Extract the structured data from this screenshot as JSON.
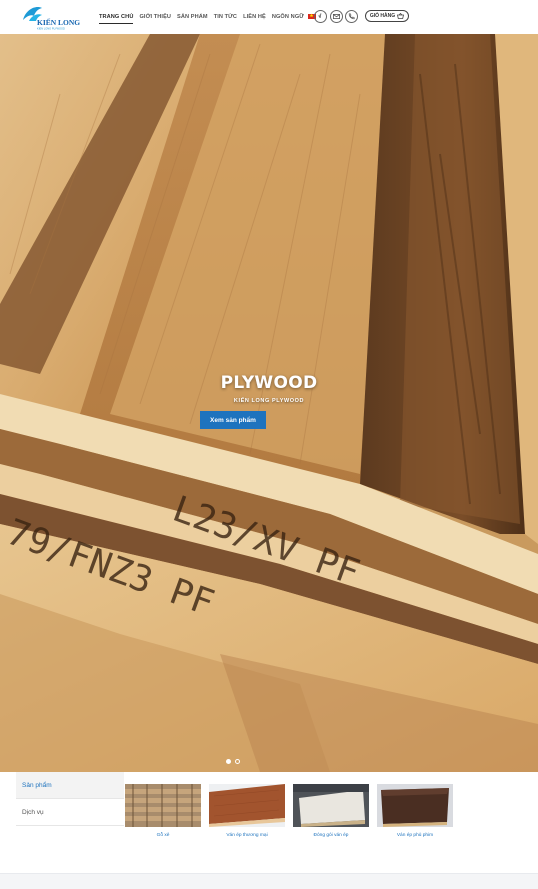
{
  "brand": {
    "name": "KIẾN LONG",
    "tagline": "KIEN LONG PLYWOOD"
  },
  "nav": {
    "items": [
      {
        "label": "TRANG CHỦ",
        "active": true
      },
      {
        "label": "GIỚI THIỆU"
      },
      {
        "label": "SẢN PHẨM"
      },
      {
        "label": "TIN TỨC"
      },
      {
        "label": "LIÊN HỆ"
      },
      {
        "label": "NGÔN NGỮ"
      }
    ],
    "language_flag": "vietnam-flag-icon",
    "social_icons": [
      "facebook-icon",
      "mail-icon",
      "phone-icon"
    ],
    "cart_label": "GIỎ HÀNG",
    "cart_icon": "basket-icon"
  },
  "hero": {
    "title": "PLYWOOD",
    "subtitle": "KIẾN LONG PLYWOOD",
    "button_label": "Xem sản phẩm",
    "slide_count": 2,
    "active_slide": 1,
    "stamps": [
      "79/FNZ3 PF",
      "L23/XV PF"
    ]
  },
  "tabs": [
    {
      "label": "Sản phẩm",
      "active": true
    },
    {
      "label": "Dịch vụ",
      "active": false
    }
  ],
  "products": [
    {
      "caption": "Gỗ xẻ"
    },
    {
      "caption": "Ván ép thương mại"
    },
    {
      "caption": "Đóng gói ván ép"
    },
    {
      "caption": "Ván ép phủ phim"
    }
  ],
  "colors": {
    "accent": "#1e73be",
    "text": "#333333",
    "flag_red": "#da251d",
    "flag_star": "#ffde00"
  }
}
